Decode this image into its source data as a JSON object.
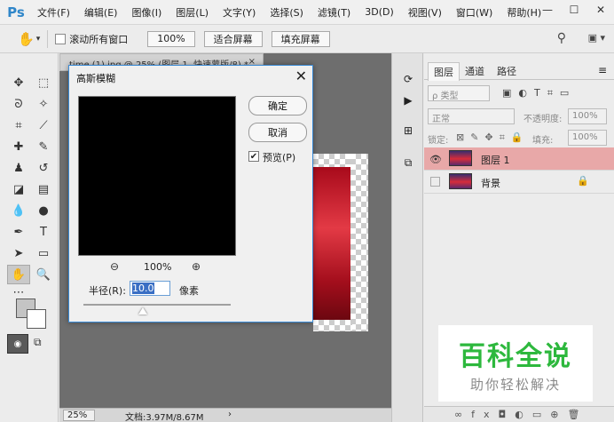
{
  "menubar": {
    "logo": "Ps",
    "items": [
      "文件(F)",
      "编辑(E)",
      "图像(I)",
      "图层(L)",
      "文字(Y)",
      "选择(S)",
      "滤镜(T)",
      "3D(D)",
      "视图(V)",
      "窗口(W)",
      "帮助(H)"
    ],
    "window_controls": [
      "—",
      "☐",
      "✕"
    ]
  },
  "options_bar": {
    "scroll_all_label": "滚动所有窗口",
    "zoom_value": "100%",
    "fit_screen_label": "适合屏幕",
    "fill_screen_label": "填充屏幕"
  },
  "document": {
    "tab_title": "time (1).jpg @ 25% (图层 1, 快速蒙版/8) *",
    "zoom": "25%",
    "info": "文档:3.97M/8.67M",
    "status_arrow": "›"
  },
  "dialog": {
    "title": "高斯模糊",
    "ok_label": "确定",
    "cancel_label": "取消",
    "preview_label": "预览(P)",
    "preview_checked": true,
    "zoom_percent": "100%",
    "radius_label": "半径(R):",
    "radius_value": "10.0",
    "radius_unit": "像素"
  },
  "layers_panel": {
    "tabs": [
      "图层",
      "通道",
      "路径"
    ],
    "active_tab": "图层",
    "filter_label": "ρ 类型",
    "blend_mode": "正常",
    "opacity_label": "不透明度:",
    "opacity_value": "100%",
    "lock_label": "锁定:",
    "fill_label": "填充:",
    "fill_value": "100%",
    "layers": [
      {
        "name": "图层 1",
        "visible": true,
        "selected": true,
        "locked": false
      },
      {
        "name": "背景",
        "visible": false,
        "selected": false,
        "locked": true
      }
    ]
  },
  "watermark": {
    "title": "百科全说",
    "subtitle": "助你轻松解决"
  }
}
